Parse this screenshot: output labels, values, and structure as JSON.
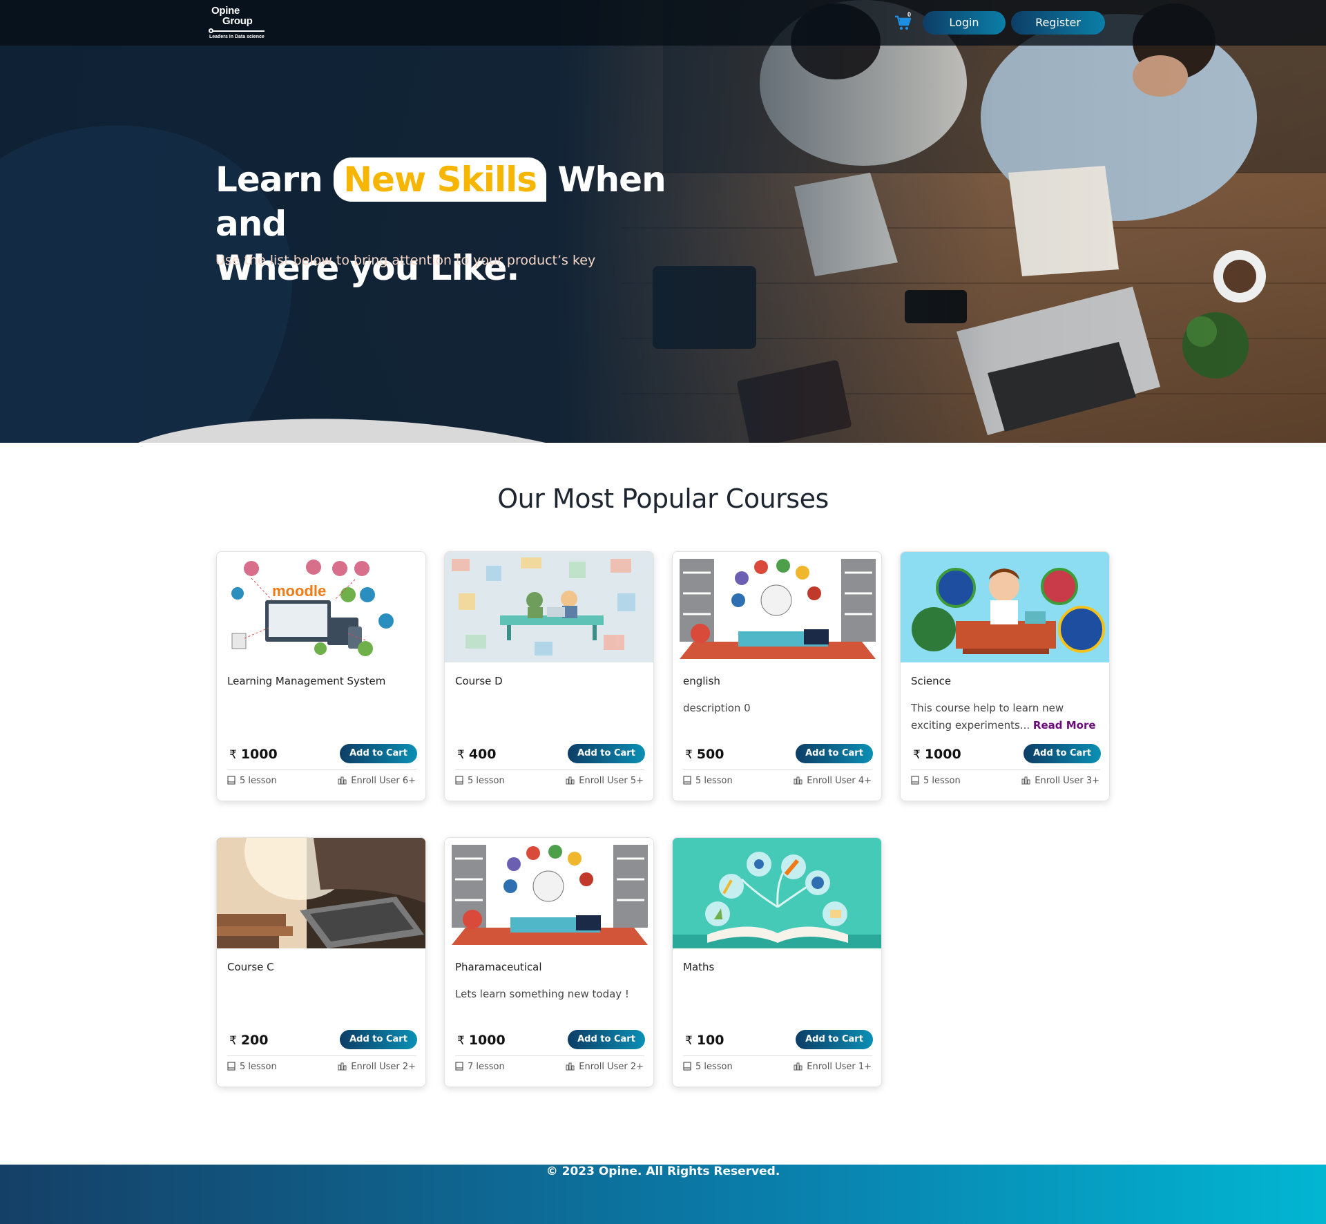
{
  "header": {
    "logo_line1": "Opine",
    "logo_line2": "Group",
    "logo_tagline": "Leaders in Data science",
    "cart_count": "0",
    "login_label": "Login",
    "register_label": "Register"
  },
  "hero": {
    "title_part1": "Learn",
    "title_highlight": "New Skills",
    "title_part2": "When and",
    "title_line2": "Where you Like.",
    "subtitle": "Use the list below to bring attention to your product’s key"
  },
  "courses": {
    "heading": "Our Most Popular Courses",
    "currency_symbol": "₹",
    "add_to_cart_label": "Add to Cart",
    "items": [
      {
        "title": "Learning Management System",
        "description": "",
        "read_more": "",
        "price": "1000",
        "lessons": "5 lesson",
        "enroll": "Enroll User 6+",
        "image": "moodle-network"
      },
      {
        "title": "Course D",
        "description": "",
        "read_more": "",
        "price": "400",
        "lessons": "5 lesson",
        "enroll": "Enroll User 5+",
        "image": "pattern-meeting"
      },
      {
        "title": "english",
        "description": "description 0",
        "read_more": "",
        "price": "500",
        "lessons": "5 lesson",
        "enroll": "Enroll User 4+",
        "image": "student-desk"
      },
      {
        "title": "Science",
        "description": "This course help to learn new exciting experiments...",
        "read_more": "Read More",
        "price": "1000",
        "lessons": "5 lesson",
        "enroll": "Enroll User 3+",
        "image": "scientist-lab"
      },
      {
        "title": "Course C",
        "description": "",
        "read_more": "",
        "price": "200",
        "lessons": "5 lesson",
        "enroll": "Enroll User 2+",
        "image": "laptop-typing"
      },
      {
        "title": "Pharamaceutical",
        "description": "Lets learn something new today !",
        "read_more": "",
        "price": "1000",
        "lessons": "7 lesson",
        "enroll": "Enroll User 2+",
        "image": "student-desk"
      },
      {
        "title": "Maths",
        "description": "",
        "read_more": "",
        "price": "100",
        "lessons": "5 lesson",
        "enroll": "Enroll User 1+",
        "image": "open-book"
      }
    ]
  },
  "footer": {
    "copyright": "© 2023 Opine. All Rights Reserved."
  },
  "colors": {
    "hero_dark": "#0f2235",
    "highlight_text": "#f5b500",
    "button_gradient_start": "#0d3e66",
    "button_gradient_end": "#0b8fb4",
    "read_more": "#6b0a7a",
    "footer_gradient_end": "#02b6d2"
  }
}
